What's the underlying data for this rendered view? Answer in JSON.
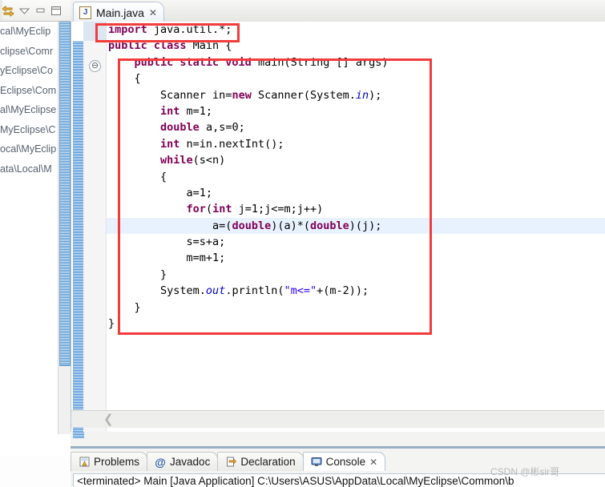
{
  "window": {
    "left_toolbar_icons": [
      "link-with-editor-icon",
      "view-menu-chevron-icon",
      "minimize-icon",
      "maximize-icon"
    ]
  },
  "left_panel": {
    "paths": [
      "cal\\MyEclip",
      "clipse\\Comr",
      "yEclipse\\Co",
      "Eclipse\\Com",
      "al\\MyEclipse",
      "MyEclipse\\C",
      "ocal\\MyEclip",
      "ata\\Local\\M"
    ]
  },
  "editor": {
    "tab": {
      "label": "Main.java",
      "icon": "java-file-icon",
      "close": "✕"
    },
    "fold_icon": "⊖",
    "scroll_left_arrow": "❮",
    "caret_line_index": 13,
    "lines": [
      [
        {
          "t": "import ",
          "c": "kw"
        },
        {
          "t": "java.util.*;",
          "c": "cur"
        }
      ],
      [
        {
          "t": "public class ",
          "c": "kw"
        },
        {
          "t": "Main {",
          "c": "cur"
        }
      ],
      [
        {
          "t": "    ",
          "c": "cur"
        },
        {
          "t": "public static void ",
          "c": "kw"
        },
        {
          "t": "main(String [] args)",
          "c": "cur"
        }
      ],
      [
        {
          "t": "    {",
          "c": "cur"
        }
      ],
      [
        {
          "t": "        Scanner in=",
          "c": "cur"
        },
        {
          "t": "new ",
          "c": "kw"
        },
        {
          "t": "Scanner(System.",
          "c": "cur"
        },
        {
          "t": "in",
          "c": "fld"
        },
        {
          "t": ");",
          "c": "cur"
        }
      ],
      [
        {
          "t": "        ",
          "c": "cur"
        },
        {
          "t": "int ",
          "c": "kw"
        },
        {
          "t": "m=1;",
          "c": "cur"
        }
      ],
      [
        {
          "t": "        ",
          "c": "cur"
        },
        {
          "t": "double ",
          "c": "kw"
        },
        {
          "t": "a,s=0;",
          "c": "cur"
        }
      ],
      [
        {
          "t": "        ",
          "c": "cur"
        },
        {
          "t": "int ",
          "c": "kw"
        },
        {
          "t": "n=in.nextInt();",
          "c": "cur"
        }
      ],
      [
        {
          "t": "        ",
          "c": "cur"
        },
        {
          "t": "while",
          "c": "kw"
        },
        {
          "t": "(s<n)",
          "c": "cur"
        }
      ],
      [
        {
          "t": "        {",
          "c": "cur"
        }
      ],
      [
        {
          "t": "            a=1;",
          "c": "cur"
        }
      ],
      [
        {
          "t": "            ",
          "c": "cur"
        },
        {
          "t": "for",
          "c": "kw"
        },
        {
          "t": "(",
          "c": "cur"
        },
        {
          "t": "int ",
          "c": "kw"
        },
        {
          "t": "j=1;j<=m;j++)",
          "c": "cur"
        }
      ],
      [
        {
          "t": "                a=(",
          "c": "cur"
        },
        {
          "t": "double",
          "c": "kw"
        },
        {
          "t": ")(a)*(",
          "c": "cur"
        },
        {
          "t": "double",
          "c": "kw"
        },
        {
          "t": ")(j);",
          "c": "cur"
        }
      ],
      [
        {
          "t": "            s=s+a;",
          "c": "cur"
        }
      ],
      [
        {
          "t": "            m=m+1;",
          "c": "cur"
        }
      ],
      [
        {
          "t": "        }",
          "c": "cur"
        }
      ],
      [
        {
          "t": "        System.",
          "c": "cur"
        },
        {
          "t": "out",
          "c": "fld"
        },
        {
          "t": ".println(",
          "c": "cur"
        },
        {
          "t": "\"m<=\"",
          "c": "str"
        },
        {
          "t": "+(m-2));",
          "c": "cur"
        }
      ],
      [
        {
          "t": "    }",
          "c": "cur"
        }
      ],
      [
        {
          "t": "}",
          "c": "cur"
        }
      ]
    ]
  },
  "bottom": {
    "tabs": [
      {
        "label": "Problems",
        "icon": "problems-icon",
        "active": false
      },
      {
        "label": "Javadoc",
        "icon": "javadoc-at-icon",
        "active": false
      },
      {
        "label": "Declaration",
        "icon": "declaration-icon",
        "active": false
      },
      {
        "label": "Console",
        "icon": "console-icon",
        "active": true
      }
    ],
    "console_close": "✕",
    "console_text": "<terminated> Main [Java Application] C:\\Users\\ASUS\\AppData\\Local\\MyEclipse\\Common\\b"
  },
  "watermark": {
    "text": "CSDN @彬sir哥"
  },
  "colors": {
    "annotation_red": "#f23c3c",
    "keyword": "#7f0055",
    "string": "#2a00ff",
    "field": "#0000c0",
    "current_line": "#e8f2fe"
  }
}
